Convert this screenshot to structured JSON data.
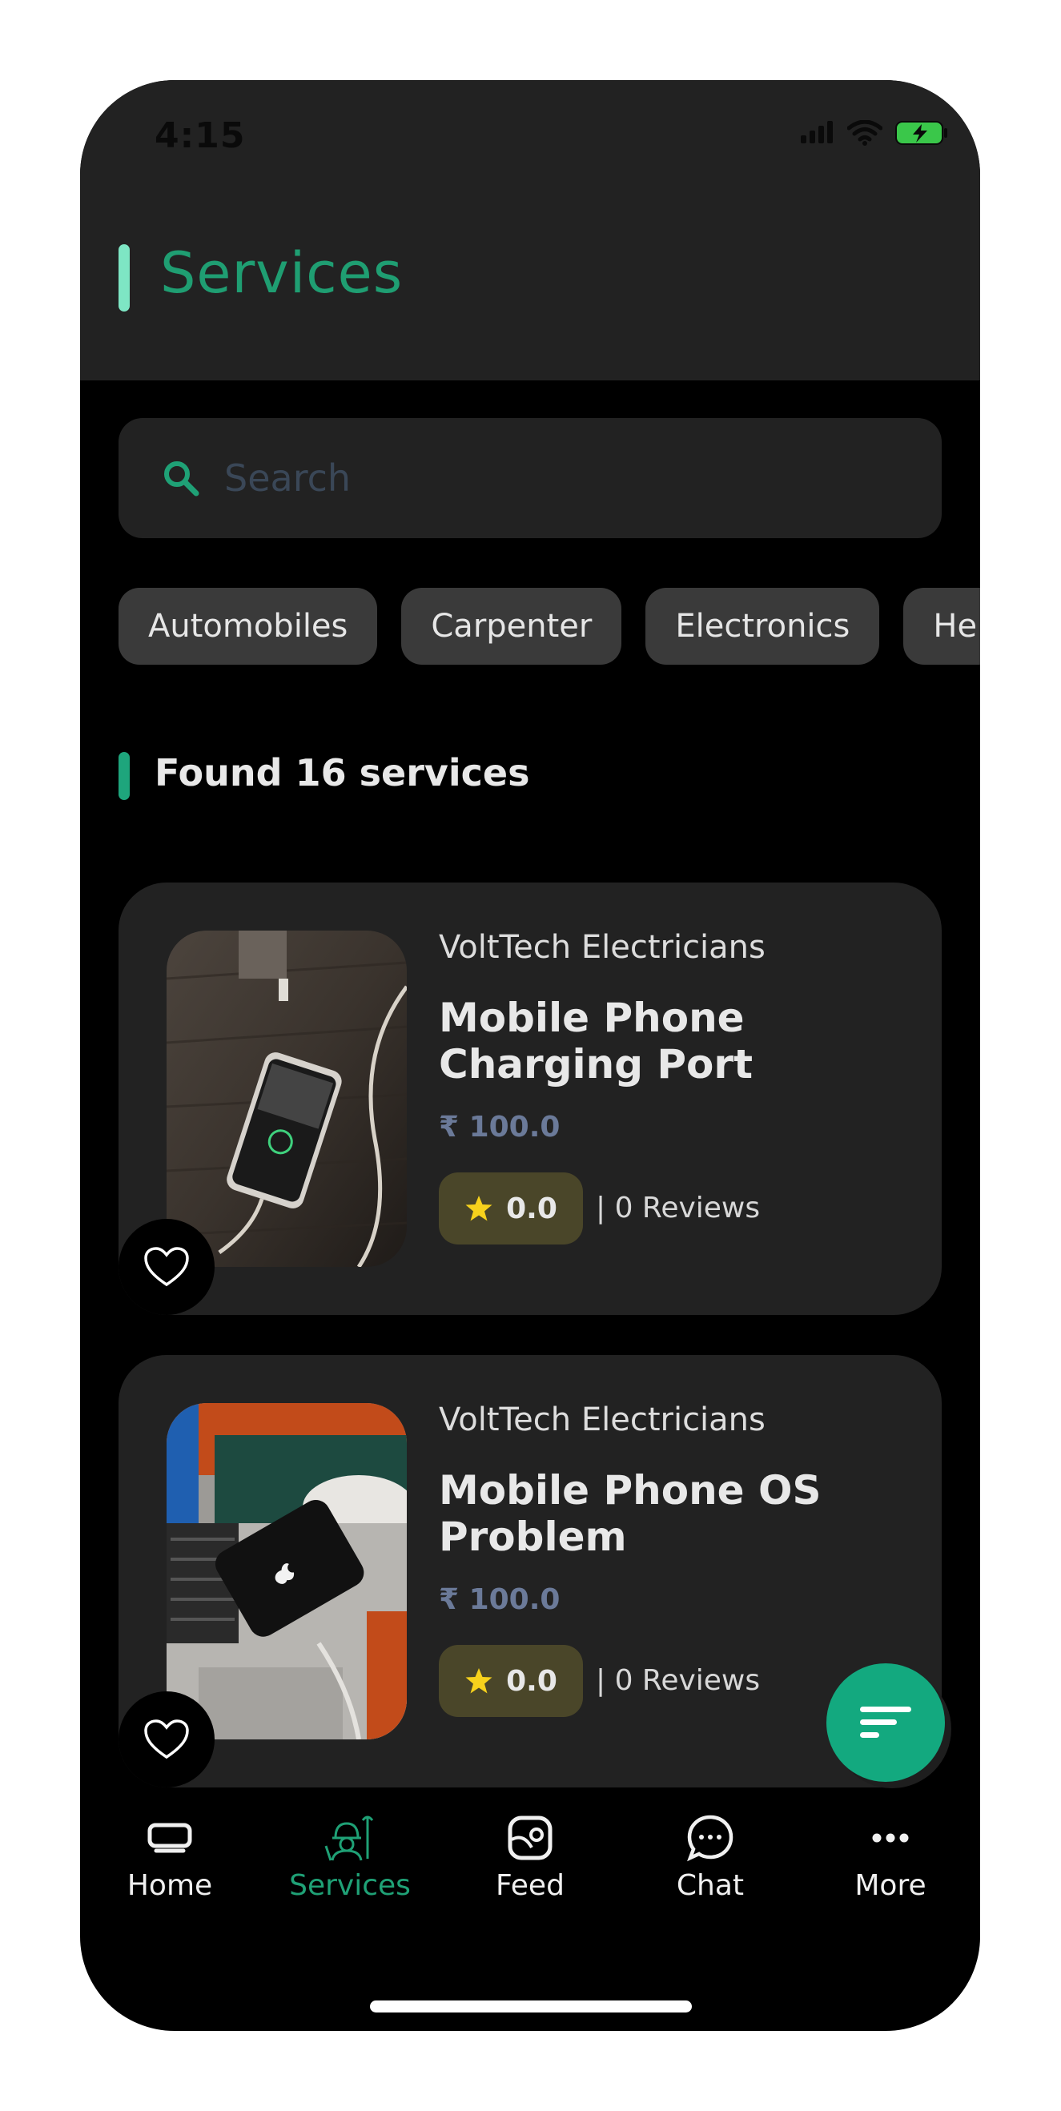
{
  "status": {
    "time": "4:15"
  },
  "header": {
    "title": "Services"
  },
  "search": {
    "placeholder": "Search"
  },
  "categories": [
    "Automobiles",
    "Carpenter",
    "Electronics",
    "He"
  ],
  "found_text": "Found 16 services",
  "services": [
    {
      "provider": "VoltTech Electricians",
      "name": "Mobile Phone Charging Port",
      "price": "₹ 100.0",
      "rating": "0.0",
      "reviews": "| 0 Reviews"
    },
    {
      "provider": "VoltTech Electricians",
      "name": "Mobile Phone OS Problem",
      "price": "₹ 100.0",
      "rating": "0.0",
      "reviews": "| 0 Reviews"
    }
  ],
  "nav": {
    "items": [
      {
        "label": "Home",
        "icon": "home-icon"
      },
      {
        "label": "Services",
        "icon": "services-icon"
      },
      {
        "label": "Feed",
        "icon": "feed-icon"
      },
      {
        "label": "Chat",
        "icon": "chat-icon"
      },
      {
        "label": "More",
        "icon": "more-icon"
      }
    ],
    "active": "Services"
  },
  "colors": {
    "accent": "#1fa176",
    "fab": "#13a97f",
    "star": "#f7d21c"
  }
}
